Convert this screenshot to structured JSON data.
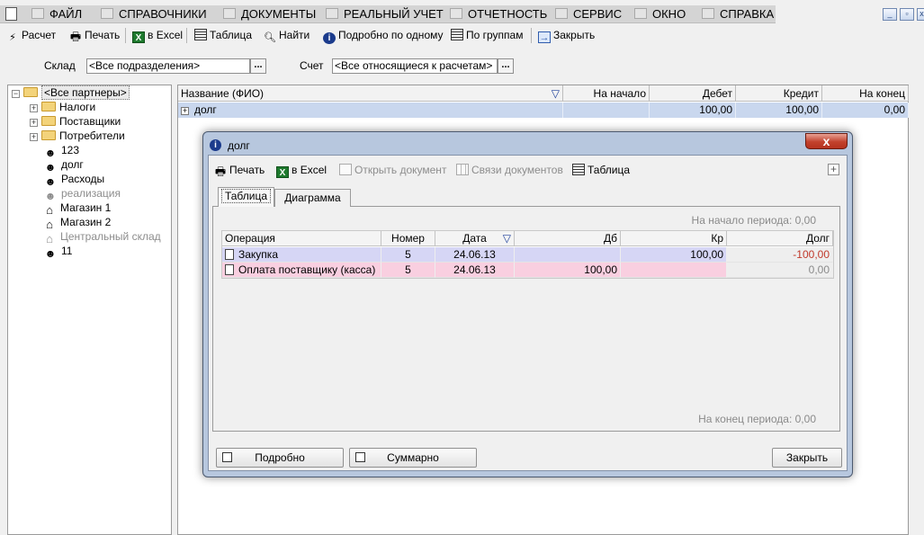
{
  "menu": {
    "items": [
      {
        "label": "ФАЙЛ",
        "icon": "folder-open-icon"
      },
      {
        "label": "СПРАВОЧНИКИ",
        "icon": "home-icon"
      },
      {
        "label": "ДОКУМЕНТЫ",
        "icon": "document-icon"
      },
      {
        "label": "РЕАЛЬНЫЙ УЧЕТ",
        "icon": "ledger-icon"
      },
      {
        "label": "ОТЧЕТНОСТЬ",
        "icon": "report-icon"
      },
      {
        "label": "СЕРВИС",
        "icon": "service-icon"
      },
      {
        "label": "ОКНО",
        "icon": "window-icon"
      },
      {
        "label": "СПРАВКА",
        "icon": "help-icon"
      }
    ]
  },
  "toolbar": {
    "calc": "Расчет",
    "print": "Печать",
    "excel": "в Excel",
    "table": "Таблица",
    "find": "Найти",
    "detail_one": "Подробно по одному",
    "by_groups": "По группам",
    "close": "Закрыть"
  },
  "filters": {
    "warehouse_label": "Склад",
    "warehouse_value": "<Все подразделения>",
    "account_label": "Счет",
    "account_value": "<Все относящиеся к расчетам>",
    "ellipsis": "..."
  },
  "tree": {
    "root": "<Все партнеры>",
    "items": [
      {
        "label": "Налоги",
        "type": "folder"
      },
      {
        "label": "Поставщики",
        "type": "folder"
      },
      {
        "label": "Потребители",
        "type": "folder"
      },
      {
        "label": "123",
        "type": "person"
      },
      {
        "label": "долг",
        "type": "person"
      },
      {
        "label": "Расходы",
        "type": "person"
      },
      {
        "label": "реализация",
        "type": "person",
        "disabled": true
      },
      {
        "label": "Магазин 1",
        "type": "house"
      },
      {
        "label": "Магазин 2",
        "type": "house"
      },
      {
        "label": "Центральный склад",
        "type": "house",
        "disabled": true
      },
      {
        "label": "11",
        "type": "person"
      }
    ]
  },
  "main_grid": {
    "columns": [
      "Название (ФИО)",
      "На начало",
      "Дебет",
      "Кредит",
      "На конец"
    ],
    "row": {
      "name": "долг",
      "start": "",
      "debit": "100,00",
      "credit": "100,00",
      "end": "0,00"
    }
  },
  "dialog": {
    "title": "долг",
    "close_glyph": "x",
    "toolbar": {
      "print": "Печать",
      "excel": "в Excel",
      "open_doc": "Открыть документ",
      "doc_links": "Связи документов",
      "table": "Таблица"
    },
    "tabs": [
      "Таблица",
      "Диаграмма"
    ],
    "start_period": "На начало периода: 0,00",
    "end_period": "На конец периода: 0,00",
    "columns": [
      "Операция",
      "Номер",
      "Дата",
      "Дб",
      "Кр",
      "Долг"
    ],
    "rows": [
      {
        "op": "Закупка",
        "num": "5",
        "date": "24.06.13",
        "debit": "",
        "credit": "100,00",
        "debt": "-100,00"
      },
      {
        "op": "Оплата поставщику (касса)",
        "num": "5",
        "date": "24.06.13",
        "debit": "100,00",
        "credit": "",
        "debt": "0,00"
      }
    ],
    "buttons": {
      "detailed": "Подробно",
      "summary": "Суммарно",
      "close": "Закрыть"
    }
  },
  "colors": {
    "selected_row": "#c9d7ee",
    "purchase_row": "#d6d6f5",
    "payment_row": "#f9cfe0",
    "negative_value": "#c0392b"
  }
}
